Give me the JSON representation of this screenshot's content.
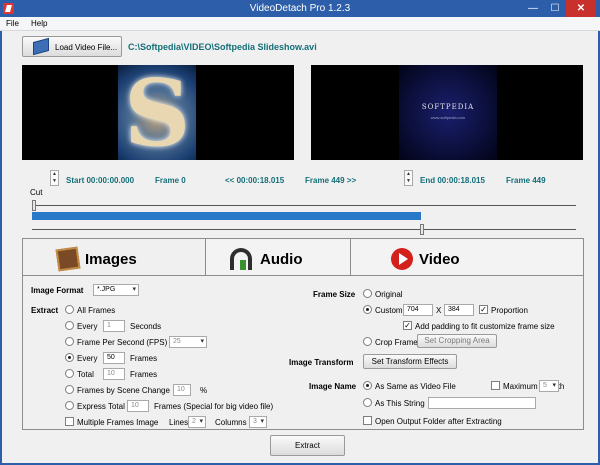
{
  "window": {
    "title": "VideoDetach Pro 1.2.3",
    "min": "—",
    "max": "☐",
    "close": "✕"
  },
  "menu": [
    "File",
    "Help"
  ],
  "load": {
    "label": "Load Video File...",
    "path": "C:\\Softpedia\\VIDEO\\Softpedia Slideshow.avi"
  },
  "preview": {
    "left_glyph": "S",
    "right_title": "SOFTPEDIA",
    "right_sub": "www.softpedia.com"
  },
  "timeline": {
    "start_label": "Start 00:00:00.000",
    "start_frame": "Frame 0",
    "mid_label": "<< 00:00:18.015",
    "mid_frame": "Frame 449 >>",
    "end_label": "End 00:00:18.015",
    "end_frame": "Frame 449",
    "cut_label": "Cut",
    "progress_fraction": 0.72
  },
  "tabs": {
    "images": "Images",
    "audio": "Audio",
    "video": "Video"
  },
  "images": {
    "image_format_label": "Image Format",
    "image_format_value": "*.JPG",
    "extract_label": "Extract",
    "all_frames": "All Frames",
    "every_seconds_pre": "Every",
    "every_seconds_value": "1",
    "every_seconds_post": "Seconds",
    "fps_label": "Frame Per Second (FPS)",
    "fps_value": "25",
    "every_frames_pre": "Every",
    "every_frames_value": "50",
    "every_frames_post": "Frames",
    "total_pre": "Total",
    "total_value": "10",
    "total_post": "Frames",
    "scene_label": "Frames by Scene Change",
    "scene_value": "10",
    "scene_unit": "%",
    "express_pre": "Express Total",
    "express_value": "10",
    "express_post": "Frames (Special for big video file)",
    "multiple_label": "Multiple Frames Image",
    "lines_label": "Lines",
    "lines_value": "2",
    "columns_label": "Columns",
    "columns_value": "3",
    "frame_size_label": "Frame Size",
    "original": "Original",
    "custom": "Custom",
    "width": "704",
    "x_sep": "X",
    "height": "384",
    "proportion": "Proportion",
    "padding": "Add padding to fit customize frame size",
    "crop": "Crop Frame",
    "crop_button": "Set Cropping Area",
    "transform_label": "Image Transform",
    "transform_button": "Set Transform Effects",
    "name_label": "Image Name",
    "same_as_video": "As Same as Video File",
    "max_length": "Maximum Length",
    "max_length_value": "5",
    "this_string": "As This String",
    "open_output": "Open Output Folder after Extracting"
  },
  "extract_button": "Extract",
  "colors": {
    "accent": "#146e78",
    "title_bar": "#2d5ea9",
    "progress": "#2a78c8"
  }
}
